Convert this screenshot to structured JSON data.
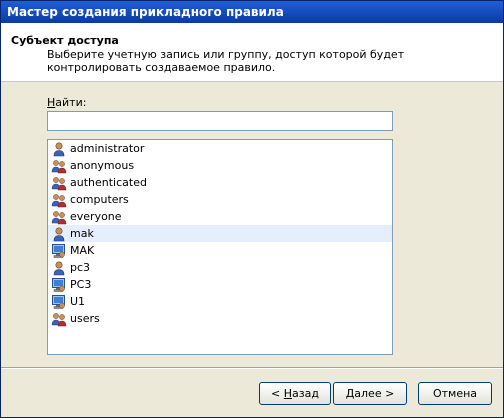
{
  "window": {
    "title": "Мастер создания прикладного правила"
  },
  "header": {
    "title": "Субъект доступа",
    "description": "Выберите учетную запись или группу, доступ которой будет контролировать создаваемое правило."
  },
  "search": {
    "label_first": "Н",
    "label_rest": "айти:",
    "value": ""
  },
  "list": {
    "items": [
      {
        "label": "administrator",
        "icon": "user-icon"
      },
      {
        "label": "anonymous",
        "icon": "group-icon"
      },
      {
        "label": "authenticated",
        "icon": "group-icon"
      },
      {
        "label": "computers",
        "icon": "group-icon"
      },
      {
        "label": "everyone",
        "icon": "group-icon"
      },
      {
        "label": "mak",
        "icon": "user-icon",
        "selected": true
      },
      {
        "label": "MAK",
        "icon": "computer-icon"
      },
      {
        "label": "pc3",
        "icon": "user-icon"
      },
      {
        "label": "PC3",
        "icon": "computer-icon"
      },
      {
        "label": "U1",
        "icon": "computer-icon"
      },
      {
        "label": "users",
        "icon": "group-icon"
      }
    ]
  },
  "buttons": {
    "back_prefix": "< ",
    "back_underline": "Н",
    "back_rest": "азад",
    "next_underline": "Д",
    "next_rest": "алее >",
    "cancel": "Отмена"
  }
}
